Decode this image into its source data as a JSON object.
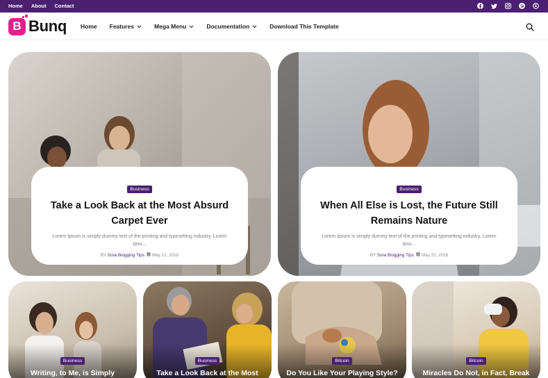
{
  "topbar": {
    "links": [
      "Home",
      "About",
      "Contact"
    ],
    "social_icons": [
      "facebook-icon",
      "twitter-icon",
      "instagram-icon",
      "pinterest-icon",
      "skype-icon"
    ]
  },
  "header": {
    "logo_letter": "B",
    "logo_text": "Bunq",
    "nav": [
      {
        "label": "Home",
        "dropdown": false
      },
      {
        "label": "Features",
        "dropdown": true
      },
      {
        "label": "Mega Menu",
        "dropdown": true
      },
      {
        "label": "Documentation",
        "dropdown": true
      },
      {
        "label": "Download This Template",
        "dropdown": false
      }
    ],
    "search_icon": "search-icon"
  },
  "featured": [
    {
      "tag": "Business",
      "title": "Take a Look Back at the Most Absurd Carpet Ever",
      "excerpt": "Lorem Ipsum is simply dummy text of the printing and typesetting industry. Lorem Ipsu...",
      "by": "BY",
      "author": "Sora Blogging Tips",
      "date": "May 21, 2018"
    },
    {
      "tag": "Business",
      "title": "When All Else is Lost, the Future Still Remains Nature",
      "excerpt": "Lorem Ipsum is simply dummy text of the printing and typesetting industry. Lorem Ipsu...",
      "by": "BY",
      "author": "Sora Blogging Tips",
      "date": "May 22, 2018"
    }
  ],
  "cards": [
    {
      "tag": "Business",
      "title": "Writing, to Me, is Simply Thinking Through My Fingers"
    },
    {
      "tag": "Business",
      "title": "Take a Look Back at the Most Gala Red Carpet Ever"
    },
    {
      "tag": "Bitcoin",
      "title": "Do You Like Your Playing Style? Try New Kill La Kill"
    },
    {
      "tag": "Bitcoin",
      "title": "Miracles Do Not, in Fact, Break the Laws of Nature"
    }
  ],
  "colors": {
    "brand": "#4b1f71",
    "accent": "#e91e8c"
  }
}
